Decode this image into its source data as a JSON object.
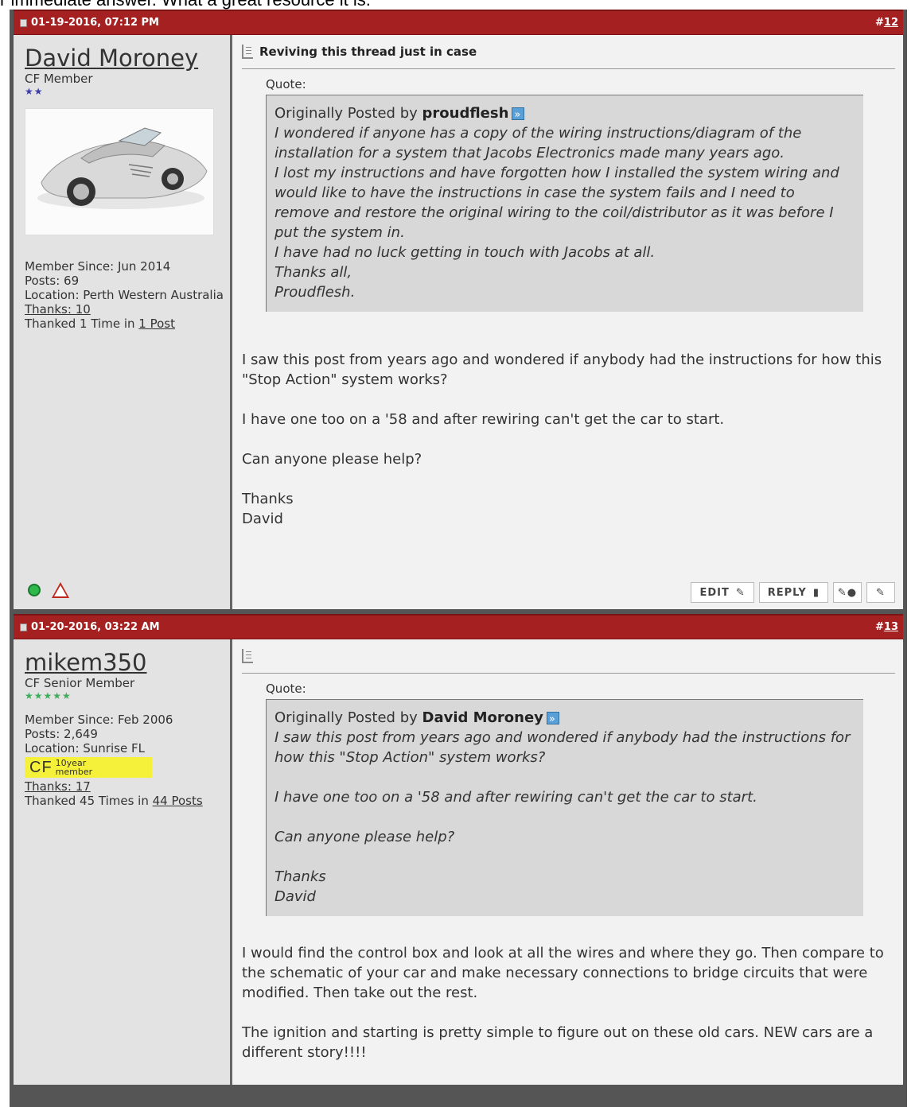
{
  "top_text": "r immediate answer.  What a great resource it is.",
  "posts": [
    {
      "date": "01-19-2016, 07:12 PM",
      "number_prefix": "#",
      "number": "12",
      "username": "David Moroney",
      "user_title": "CF Member",
      "stars": "★★",
      "member_since": "Member Since: Jun 2014",
      "posts": "Posts: 69",
      "location": "Location: Perth Western Australia",
      "thanks": "Thanks: 10",
      "thanked_pre": "Thanked 1 Time in ",
      "thanked_link": "1 Post",
      "title": "Reviving this thread just in case",
      "quote_label": "Quote:",
      "quote_by_pre": "Originally Posted by ",
      "quote_author": "proudflesh",
      "quote_text": "I wondered if anyone has a copy of the wiring instructions/diagram of the installation for a system that Jacobs Electronics made many years ago.\nI lost my instructions and have forgotten how I installed the system wiring and would like to have the instructions in case the system fails and I need to remove and restore the original wiring to the coil/distributor as it was before I put the system in.\nI have had no luck getting in touch with Jacobs at all.\nThanks all,\nProudflesh.",
      "message": "I saw this post from years ago and wondered if anybody had the instructions for how this \"Stop Action\" system works?\n\nI have one too on a '58 and after rewiring can't get the car to start.\n\nCan anyone please help?\n\nThanks\nDavid",
      "buttons": {
        "edit": "EDIT",
        "reply": "REPLY"
      }
    },
    {
      "date": "01-20-2016, 03:22 AM",
      "number_prefix": "#",
      "number": "13",
      "username": "mikem350",
      "user_title": "CF Senior Member",
      "stars": "★★★★★",
      "member_since": "Member Since: Feb 2006",
      "posts": "Posts: 2,649",
      "location": "Location: Sunrise FL",
      "badge_cf": "CF",
      "badge_line1": "10year",
      "badge_line2": "member",
      "thanks": "Thanks: 17",
      "thanked_pre": "Thanked 45 Times in ",
      "thanked_link": "44 Posts",
      "quote_label": "Quote:",
      "quote_by_pre": "Originally Posted by ",
      "quote_author": "David Moroney",
      "quote_text": "I saw this post from years ago and wondered if anybody had the instructions for how this \"Stop Action\" system works?\n\nI have one too on a '58 and after rewiring can't get the car to start.\n\nCan anyone please help?\n\nThanks\nDavid",
      "message": "I would find the control box and look at all the wires and where they go. Then compare to the schematic of your car and make necessary connections to bridge circuits that were modified. Then take out the rest.\n\nThe ignition and starting is pretty simple to figure out on these old cars. NEW cars are a different story!!!!"
    }
  ]
}
